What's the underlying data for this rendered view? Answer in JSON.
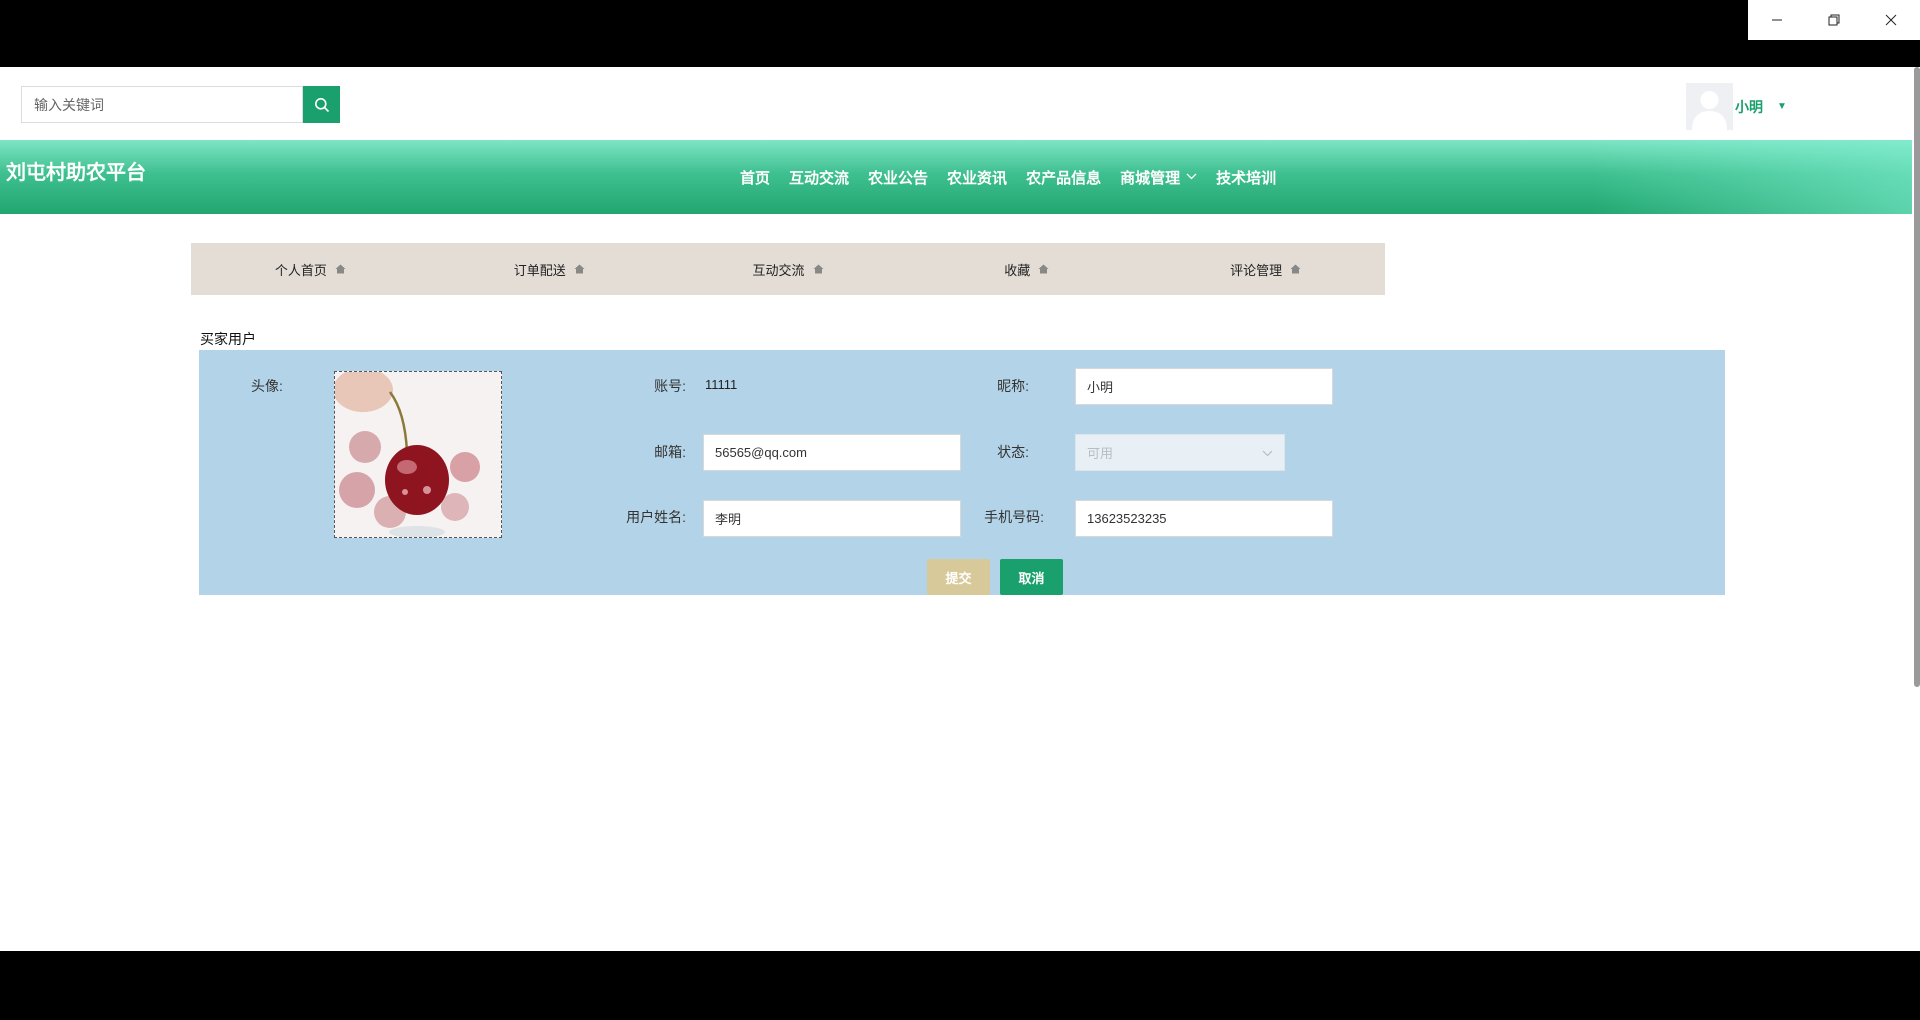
{
  "window": {
    "minimize_icon": "minimize-icon",
    "restore_icon": "restore-icon",
    "close_icon": "close-icon"
  },
  "search": {
    "placeholder": "输入关键词",
    "icon": "search-icon"
  },
  "user": {
    "name": "小明"
  },
  "brand": "刘屯村助农平台",
  "nav": {
    "items": [
      "首页",
      "互动交流",
      "农业公告",
      "农业资讯",
      "农产品信息",
      "商城管理",
      "技术培训"
    ]
  },
  "subnav": {
    "items": [
      "个人首页",
      "订单配送",
      "互动交流",
      "收藏",
      "评论管理"
    ]
  },
  "section_title": "买家用户",
  "form": {
    "avatar_label": "头像:",
    "account_label": "账号:",
    "account_value": "11111",
    "nickname_label": "昵称:",
    "nickname_value": "小明",
    "email_label": "邮箱:",
    "email_value": "56565@qq.com",
    "status_label": "状态:",
    "status_value": "可用",
    "realname_label": "用户姓名:",
    "realname_value": "李明",
    "phone_label": "手机号码:",
    "phone_value": "13623523235",
    "submit_label": "提交",
    "cancel_label": "取消"
  },
  "colors": {
    "accent": "#1aa06d",
    "panel": "#b3d4e8",
    "subnav": "#e3ddd6",
    "submit": "#d8c99a"
  }
}
